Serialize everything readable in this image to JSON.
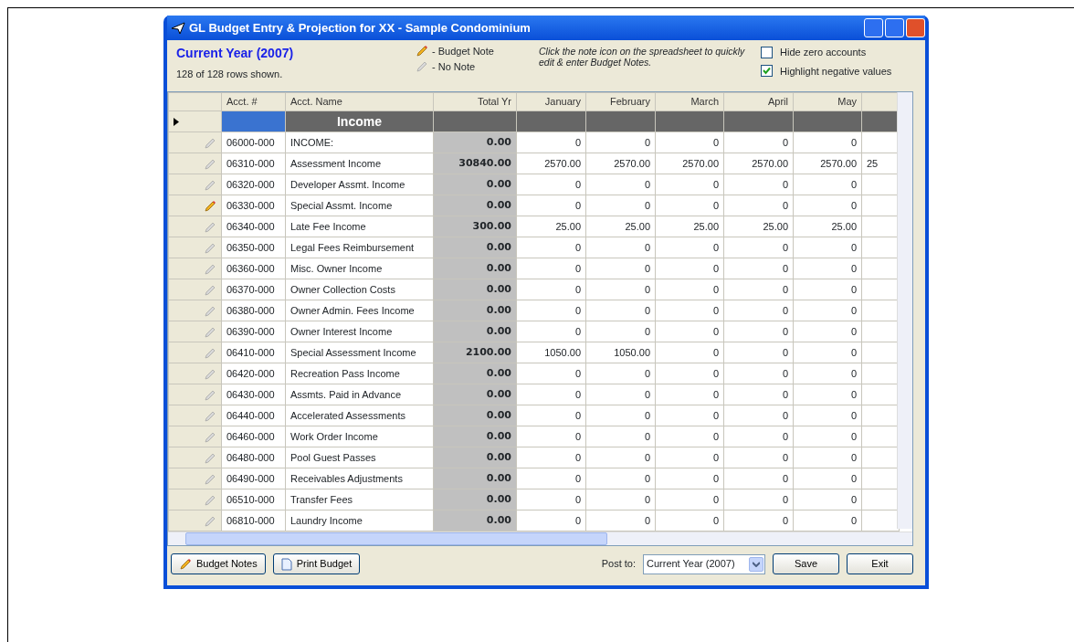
{
  "window": {
    "title": "GL Budget Entry & Projection for XX - Sample Condominium"
  },
  "heading": "Current Year (2007)",
  "row_count": "128 of 128 rows shown.",
  "legend": [
    {
      "label": "- Budget Note",
      "has_note": true
    },
    {
      "label": "- No Note",
      "has_note": false
    }
  ],
  "hint": "Click the note icon on the spreadsheet to quickly edit & enter Budget Notes.",
  "options": [
    {
      "label": "Hide zero accounts",
      "checked": false
    },
    {
      "label": "Highlight negative values",
      "checked": true
    }
  ],
  "table": {
    "columns": [
      "Acct. #",
      "Acct. Name",
      "Total Yr",
      "January",
      "February",
      "March",
      "April",
      "May"
    ],
    "section": {
      "label": "Income",
      "current": true
    },
    "rows": [
      {
        "acct": "06000-000",
        "name": "INCOME:",
        "total": "0.00",
        "months": [
          "0",
          "0",
          "0",
          "0",
          "0"
        ],
        "has_note": false
      },
      {
        "acct": "06310-000",
        "name": "Assessment Income",
        "total": "30840.00",
        "months": [
          "2570.00",
          "2570.00",
          "2570.00",
          "2570.00",
          "2570.00"
        ],
        "column_7": "25",
        "has_note": false
      },
      {
        "acct": "06320-000",
        "name": "Developer Assmt. Income",
        "total": "0.00",
        "months": [
          "0",
          "0",
          "0",
          "0",
          "0"
        ],
        "has_note": false
      },
      {
        "acct": "06330-000",
        "name": "Special Assmt. Income",
        "total": "0.00",
        "months": [
          "0",
          "0",
          "0",
          "0",
          "0"
        ],
        "has_note": true
      },
      {
        "acct": "06340-000",
        "name": "Late Fee Income",
        "total": "300.00",
        "months": [
          "25.00",
          "25.00",
          "25.00",
          "25.00",
          "25.00"
        ],
        "has_note": false
      },
      {
        "acct": "06350-000",
        "name": "Legal Fees Reimbursement",
        "total": "0.00",
        "months": [
          "0",
          "0",
          "0",
          "0",
          "0"
        ],
        "has_note": false
      },
      {
        "acct": "06360-000",
        "name": "Misc. Owner Income",
        "total": "0.00",
        "months": [
          "0",
          "0",
          "0",
          "0",
          "0"
        ],
        "has_note": false
      },
      {
        "acct": "06370-000",
        "name": "Owner Collection Costs",
        "total": "0.00",
        "months": [
          "0",
          "0",
          "0",
          "0",
          "0"
        ],
        "has_note": false
      },
      {
        "acct": "06380-000",
        "name": "Owner Admin. Fees Income",
        "total": "0.00",
        "months": [
          "0",
          "0",
          "0",
          "0",
          "0"
        ],
        "has_note": false
      },
      {
        "acct": "06390-000",
        "name": "Owner Interest Income",
        "total": "0.00",
        "months": [
          "0",
          "0",
          "0",
          "0",
          "0"
        ],
        "has_note": false
      },
      {
        "acct": "06410-000",
        "name": "Special Assessment Income",
        "total": "2100.00",
        "months": [
          "1050.00",
          "1050.00",
          "0",
          "0",
          "0"
        ],
        "has_note": false
      },
      {
        "acct": "06420-000",
        "name": "Recreation Pass Income",
        "total": "0.00",
        "months": [
          "0",
          "0",
          "0",
          "0",
          "0"
        ],
        "has_note": false
      },
      {
        "acct": "06430-000",
        "name": "Assmts. Paid in Advance",
        "total": "0.00",
        "months": [
          "0",
          "0",
          "0",
          "0",
          "0"
        ],
        "has_note": false
      },
      {
        "acct": "06440-000",
        "name": "Accelerated Assessments",
        "total": "0.00",
        "months": [
          "0",
          "0",
          "0",
          "0",
          "0"
        ],
        "has_note": false
      },
      {
        "acct": "06460-000",
        "name": "Work Order Income",
        "total": "0.00",
        "months": [
          "0",
          "0",
          "0",
          "0",
          "0"
        ],
        "has_note": false
      },
      {
        "acct": "06480-000",
        "name": "Pool Guest Passes",
        "total": "0.00",
        "months": [
          "0",
          "0",
          "0",
          "0",
          "0"
        ],
        "has_note": false
      },
      {
        "acct": "06490-000",
        "name": "Receivables Adjustments",
        "total": "0.00",
        "months": [
          "0",
          "0",
          "0",
          "0",
          "0"
        ],
        "has_note": false
      },
      {
        "acct": "06510-000",
        "name": "Transfer Fees",
        "total": "0.00",
        "months": [
          "0",
          "0",
          "0",
          "0",
          "0"
        ],
        "has_note": false
      },
      {
        "acct": "06810-000",
        "name": "Laundry Income",
        "total": "0.00",
        "months": [
          "0",
          "0",
          "0",
          "0",
          "0"
        ],
        "has_note": false
      }
    ]
  },
  "buttons_left": [
    {
      "label": "Budget Notes",
      "kind": "notes"
    },
    {
      "label": "Print Budget",
      "kind": "print"
    }
  ],
  "post_to": {
    "label": "Post to:",
    "value": "Current Year (2007)"
  },
  "buttons_right": [
    {
      "label": "Save"
    },
    {
      "label": "Exit"
    }
  ]
}
